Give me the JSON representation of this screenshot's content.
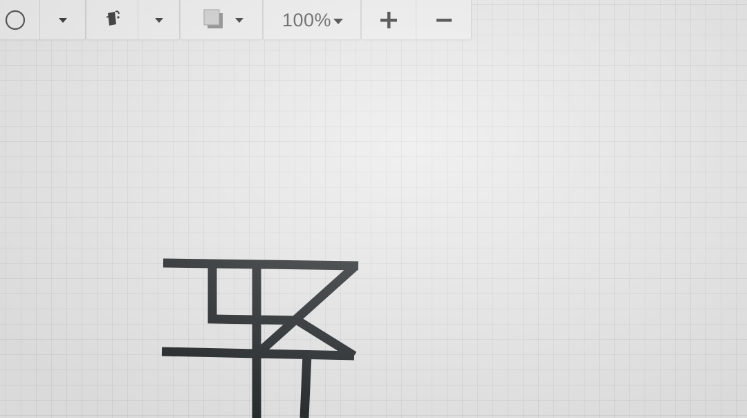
{
  "toolbar": {
    "shape_tool": {
      "icon": "circle-outline-icon"
    },
    "shape_dropdown": {
      "icon": "caret-down-icon"
    },
    "fill_tool": {
      "icon": "paint-bucket-icon"
    },
    "fill_dropdown": {
      "icon": "caret-down-icon"
    },
    "shadow_tool": {
      "icon": "shadow-square-icon"
    },
    "shadow_dropdown": {
      "icon": "caret-down-icon"
    },
    "zoom": {
      "label": "100%",
      "icon": "caret-down-icon"
    },
    "zoom_in": {
      "label": "+",
      "icon": "plus-icon"
    },
    "zoom_out": {
      "label": "−",
      "icon": "minus-icon"
    }
  },
  "canvas": {
    "grid": true,
    "stroke_color": "#1f2426"
  }
}
